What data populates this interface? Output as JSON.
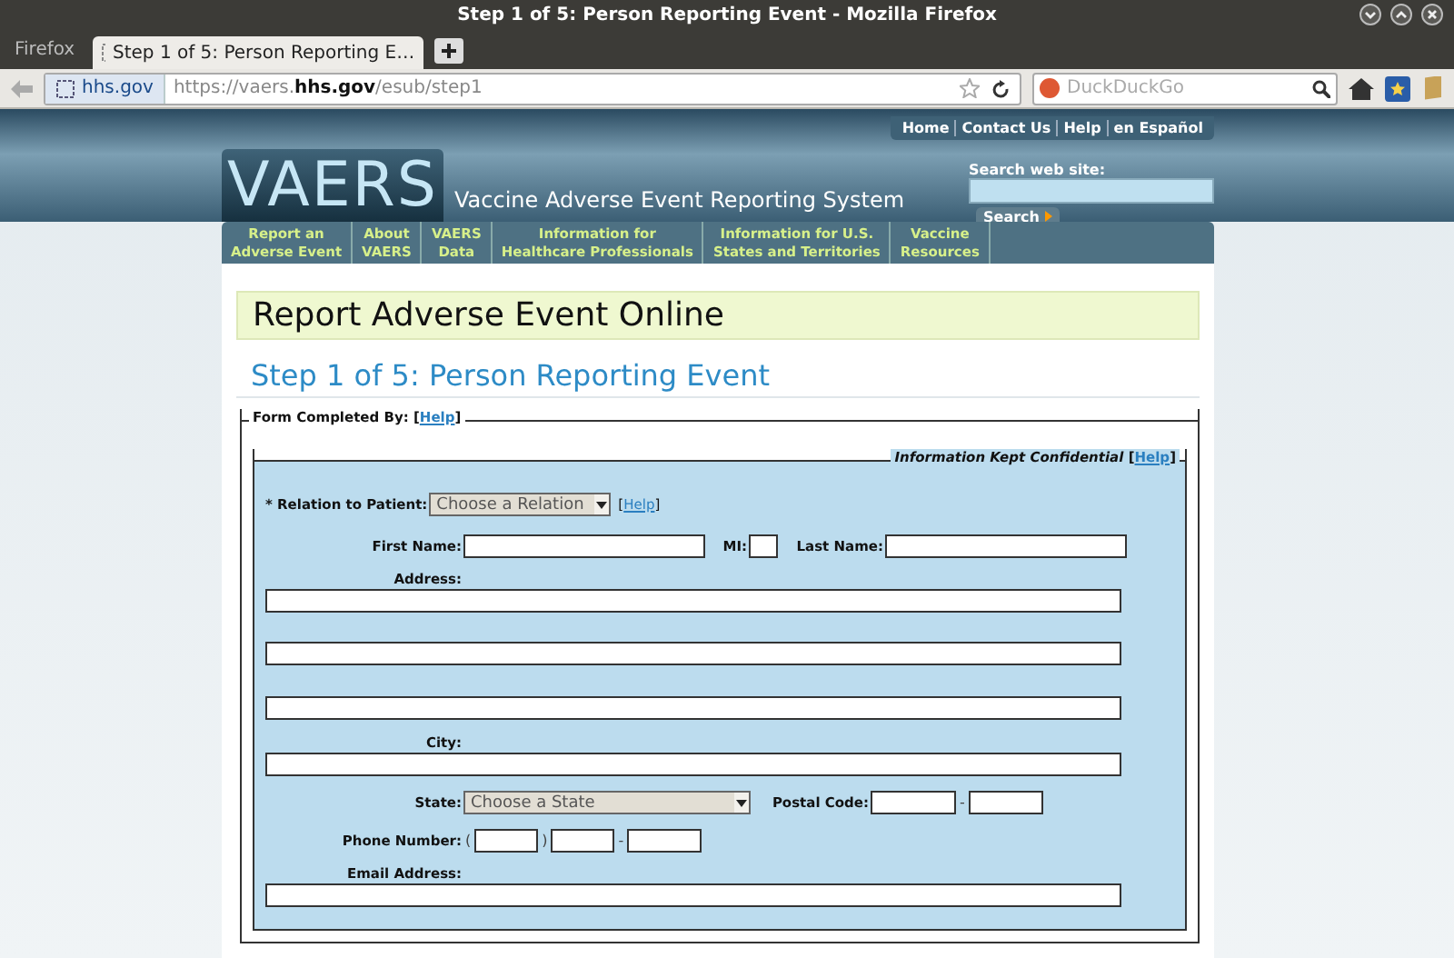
{
  "window": {
    "title": "Step 1 of 5: Person Reporting Event - Mozilla Firefox"
  },
  "browser": {
    "menu_button": "Firefox",
    "tabs": [
      {
        "label": "Step 1 of 5: Person Reporting E…",
        "selected": true
      }
    ],
    "identity": "hhs.gov",
    "url": {
      "prefix": "https://vaers.",
      "domain": "hhs.gov",
      "path": "/esub/step1"
    },
    "search_placeholder": "DuckDuckGo"
  },
  "site": {
    "top_links": [
      "Home",
      "Contact Us",
      "Help",
      "en Español"
    ],
    "logo": "VAERS",
    "tagline": "Vaccine Adverse Event Reporting System",
    "search_label": "Search web site:",
    "search_button": "Search",
    "nav": [
      {
        "lines": [
          "Report an",
          "Adverse Event"
        ]
      },
      {
        "lines": [
          "About",
          "VAERS"
        ]
      },
      {
        "lines": [
          "VAERS",
          "Data"
        ]
      },
      {
        "lines": [
          "Information for",
          "Healthcare Professionals"
        ]
      },
      {
        "lines": [
          "Information for U.S.",
          "States and Territories"
        ]
      },
      {
        "lines": [
          "Vaccine",
          "Resources"
        ]
      }
    ]
  },
  "page_title": "Report Adverse Event Online",
  "step_title": "Step 1 of 5: Person Reporting Event",
  "form": {
    "legend": "Form Completed By:",
    "legend_help": {
      "open": "[",
      "label": "Help",
      "close": "]"
    },
    "inner_legend": "Information Kept Confidential",
    "inner_help": {
      "open": "[",
      "label": "Help",
      "close": "]"
    },
    "relation": {
      "label": "* Relation to Patient:",
      "value": "Choose a Relation",
      "help": {
        "open": "[",
        "label": "Help",
        "close": "]"
      }
    },
    "first_name": "First Name:",
    "mi": "MI:",
    "last_name": "Last Name:",
    "address": "Address:",
    "city": "City:",
    "state": {
      "label": "State:",
      "value": "Choose a State"
    },
    "postal": "Postal Code:",
    "postal_sep": "-",
    "phone": "Phone Number:",
    "phone_open": "(",
    "phone_close": ")",
    "phone_sep": "-",
    "email": "Email Address:"
  }
}
